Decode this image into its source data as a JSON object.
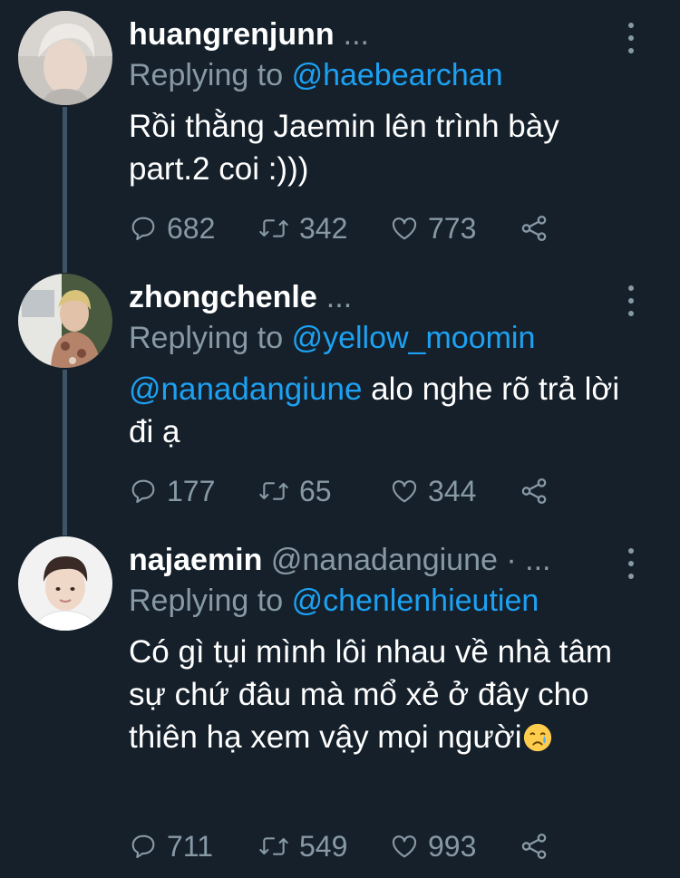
{
  "tweets": [
    {
      "username": "huangrenjunn",
      "header_suffix": "...",
      "replying_prefix": "Replying to",
      "replying_to": "@haebearchan",
      "text": "Rồi thằng Jaemin lên trình bày part.2 coi :)))",
      "replies": "682",
      "retweets": "342",
      "likes": "773"
    },
    {
      "username": "zhongchenle",
      "header_suffix": "...",
      "replying_prefix": "Replying to",
      "replying_to": "@yellow_moomin",
      "mention": "@nanadangiune",
      "text": " alo nghe rõ trả lời đi ạ",
      "replies": "177",
      "retweets": "65",
      "likes": "344"
    },
    {
      "username": "najaemin",
      "handle": "@nanadangiune",
      "header_suffix": "· ...",
      "replying_prefix": "Replying to",
      "replying_to": "@chenlenhieutien",
      "text": "Có gì tụi mình lôi nhau về nhà tâm sự chứ đâu mà mổ xẻ ở đây cho thiên hạ xem vậy mọi người",
      "emoji": "crying-face-emoji",
      "replies": "711",
      "retweets": "549",
      "likes": "993"
    }
  ],
  "colors": {
    "background": "#15202b",
    "text": "#ffffff",
    "muted": "#8899a6",
    "link": "#1da1f2",
    "thread_line": "#3d5466"
  },
  "icons": {
    "reply": "reply-icon",
    "retweet": "retweet-icon",
    "like": "heart-icon",
    "share": "share-icon",
    "more": "more-vertical-icon"
  }
}
